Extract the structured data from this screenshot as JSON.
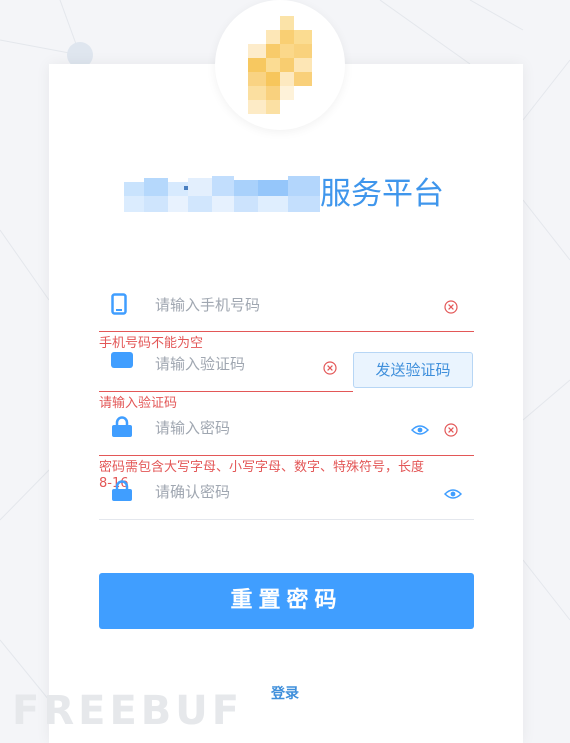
{
  "header": {
    "title_suffix": "服务平台"
  },
  "form": {
    "phone": {
      "placeholder": "请输入手机号码",
      "error": "手机号码不能为空"
    },
    "code": {
      "placeholder": "请输入验证码",
      "error": "请输入验证码",
      "send_label": "发送验证码"
    },
    "password": {
      "placeholder": "请输入密码",
      "error_line1": "密码需包含大写字母、小写字母、数字、特殊符号，长度",
      "error_line2": "8-16"
    },
    "confirm": {
      "placeholder": "请确认密码"
    },
    "submit_label": "重置密码",
    "login_label": "登录"
  },
  "watermark": "FREEBUF",
  "colors": {
    "accent": "#409eff",
    "error": "#e35757",
    "icon": "#409eff"
  },
  "icons": [
    "phone-icon",
    "message-icon",
    "lock-icon",
    "clear-icon",
    "eye-icon"
  ]
}
